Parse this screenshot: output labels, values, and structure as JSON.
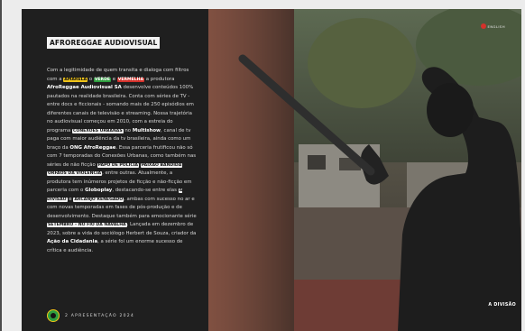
{
  "heading": "AFROREGGAE AUDIOVISUAL",
  "body": {
    "p1": "Com a legitimidade de quem transita e dialoga com filtros com a",
    "tag_amarela": "AMARELA",
    "c1": "o",
    "tag_verde": "VERDE",
    "c2": "e",
    "tag_vermelha": "VERMELHA",
    "p2": "a produtora",
    "brand1": "AfroReggae Audiovisual SA",
    "p3": "desenvolve conteúdos 100% pautados na realidade brasileira. Conta com séries de TV - entre docs e ficcionais - somando mais de 250 episódios em diferentes canais de televisão e streaming. Nossa trajetória no audiovisual começou em 2010, com a estreia do programa",
    "tag_conexoes": "CONEXÕES URBANAS",
    "p4": "no",
    "brand2": "Multishow",
    "p5": ", canal de tv paga com maior audiência da tv brasileira, ainda como um braço da",
    "brand3": "ONG AfroReggae",
    "p6": ". Essa parceria frutificou não só com 7 temporadas do Conexões Urbanas, como também nas séries de não ficção",
    "tag_papo": "PAPO DE POLÍCIA",
    "tag_paixao": "PAIXÃO BANDIDA",
    "tag_orfaos": "ÓRFÃOS DA VIOLÊNCIA",
    "p7": ", entre outras. Atualmente, a produtora tem inúmeros projetos de ficção e não-ficção em parceria com o",
    "brand4": "Globoplay",
    "p8": ", destacando-se entre elas",
    "tag_divisao": "A DIVISÃO",
    "c3": "e",
    "tag_arcanjo": "ARCANJO RENEGADO",
    "p9": ", ambas com sucesso no ar e com novas temporadas em fases de pós-produção e de desenvolvimento. Destaque também para emocionante série",
    "tag_setembro": "SETEMBRO – NO FIO DA NAVALHA",
    "p10": ". Lançada em dezembro de 2023, sobre a vida do sociólogo Herbert de Souza, criador da",
    "brand5": "Ação da Cidadania",
    "p11": ", a série foi um enorme sucesso de crítica e audiência."
  },
  "footer": {
    "page_label": "2  APRESENTAÇÃO 2024"
  },
  "photo": {
    "caption": "A DIVISÃO",
    "lang_label": "ENGLISH"
  },
  "colors": {
    "amarelo": "#f0c419",
    "verde": "#2e9e3e",
    "vermelho": "#d4312b",
    "panel": "#1f1f1f"
  },
  "icons": {
    "prev": "arrow-left-circle-icon",
    "logo": "afroreggae-logo-icon",
    "lang": "language-flag-icon"
  }
}
